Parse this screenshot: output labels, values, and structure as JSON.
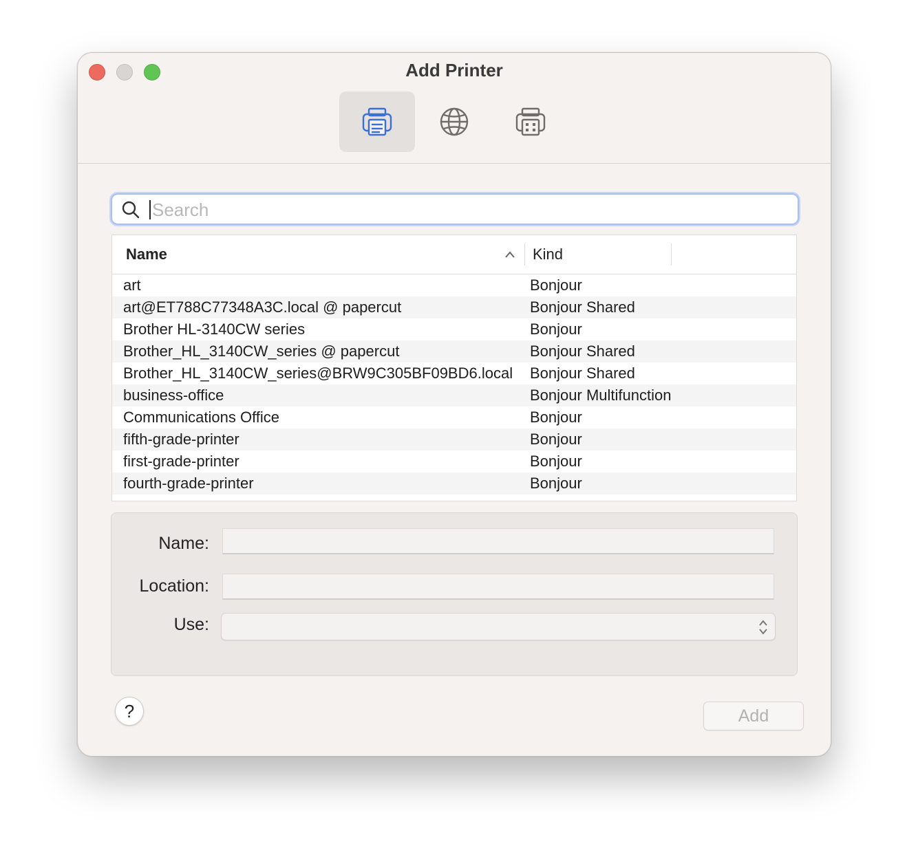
{
  "window": {
    "title": "Add Printer"
  },
  "toolbar": {
    "default_icon": "printer-icon",
    "ip_icon": "globe-icon",
    "windows_icon": "windows-printer-icon",
    "active_color": "#3a6fd8"
  },
  "search": {
    "placeholder": "Search",
    "value": ""
  },
  "table": {
    "columns": {
      "name": "Name",
      "kind": "Kind"
    },
    "rows": [
      {
        "name": "art",
        "kind": "Bonjour"
      },
      {
        "name": "art@ET788C77348A3C.local @ papercut",
        "kind": "Bonjour Shared"
      },
      {
        "name": "Brother HL-3140CW series",
        "kind": "Bonjour"
      },
      {
        "name": "Brother_HL_3140CW_series @ papercut",
        "kind": "Bonjour Shared"
      },
      {
        "name": "Brother_HL_3140CW_series@BRW9C305BF09BD6.local",
        "kind": "Bonjour Shared"
      },
      {
        "name": "business-office",
        "kind": "Bonjour Multifunction"
      },
      {
        "name": "Communications Office",
        "kind": "Bonjour"
      },
      {
        "name": "fifth-grade-printer",
        "kind": "Bonjour"
      },
      {
        "name": "first-grade-printer",
        "kind": "Bonjour"
      },
      {
        "name": "fourth-grade-printer",
        "kind": "Bonjour"
      },
      {
        "name": "",
        "kind": ""
      }
    ]
  },
  "details": {
    "name_label": "Name:",
    "location_label": "Location:",
    "use_label": "Use:",
    "name_value": "",
    "location_value": "",
    "use_value": ""
  },
  "footer": {
    "help_label": "?",
    "add_label": "Add"
  }
}
